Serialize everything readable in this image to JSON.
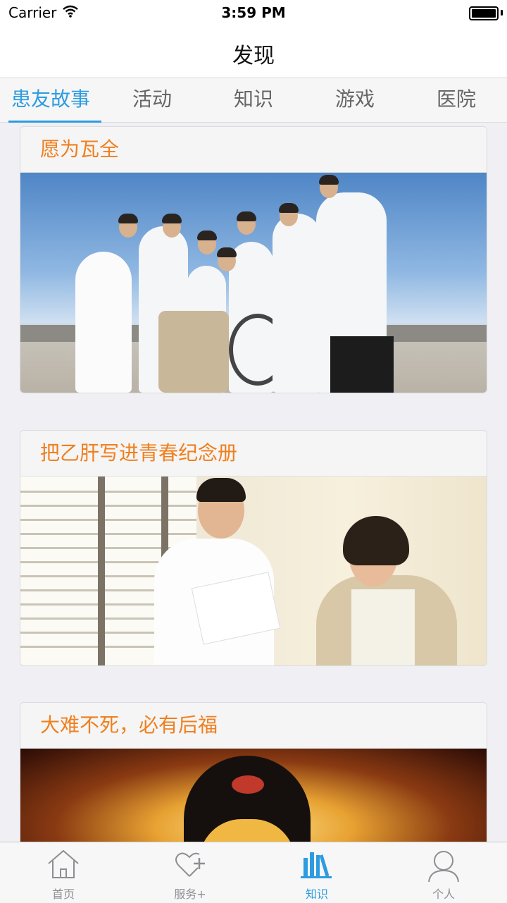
{
  "status_bar": {
    "carrier": "Carrier",
    "time": "3:59 PM"
  },
  "nav": {
    "title": "发现"
  },
  "tabs": [
    {
      "label": "患友故事",
      "active": true
    },
    {
      "label": "活动",
      "active": false
    },
    {
      "label": "知识",
      "active": false
    },
    {
      "label": "游戏",
      "active": false
    },
    {
      "label": "医院",
      "active": false
    }
  ],
  "stories": [
    {
      "title": "愿为瓦全",
      "image": "doctors-and-patient-in-wheelchair-photo"
    },
    {
      "title": "把乙肝写进青春纪念册",
      "image": "nurse-talking-with-patient-photo"
    },
    {
      "title": "大难不死，必有后福",
      "image": "golden-buddha-photo"
    }
  ],
  "tab_bar": [
    {
      "label": "首页",
      "icon": "home-icon",
      "active": false
    },
    {
      "label": "服务+",
      "icon": "heart-plus-icon",
      "active": false
    },
    {
      "label": "知识",
      "icon": "books-icon",
      "active": true
    },
    {
      "label": "个人",
      "icon": "person-icon",
      "active": false
    }
  ],
  "colors": {
    "accent": "#2d9ce0",
    "title_orange": "#f07f1e"
  }
}
